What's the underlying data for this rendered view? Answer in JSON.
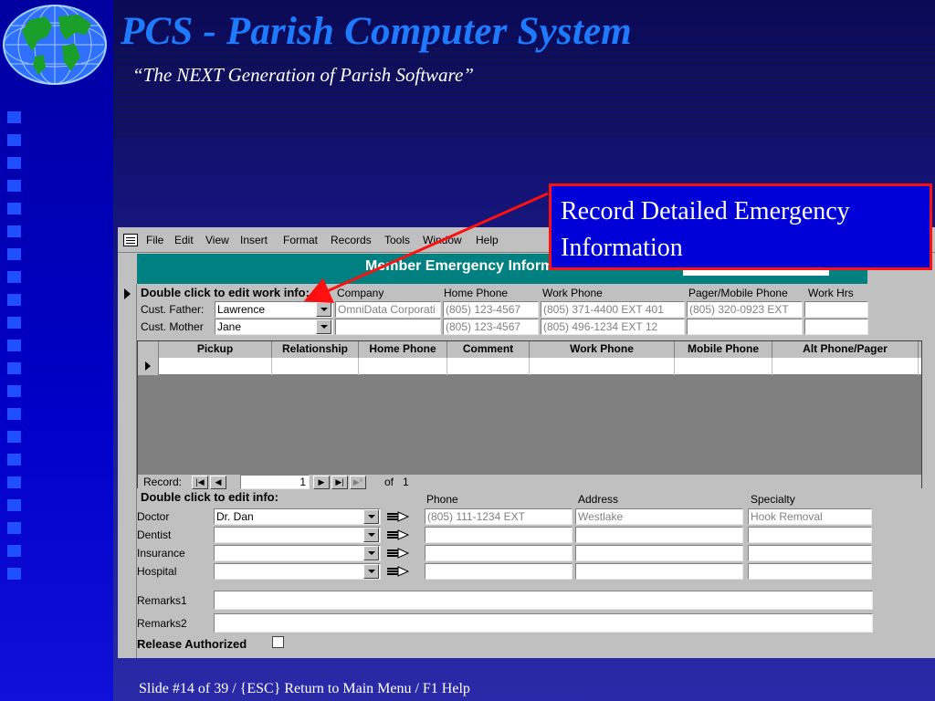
{
  "slide": {
    "title": "PCS - Parish Computer System",
    "subtitle": "“The NEXT Generation of Parish Software”",
    "footer": "Slide #14 of 39 / {ESC} Return to Main Menu / F1 Help"
  },
  "callout": {
    "text": "Record Detailed Emergency Information"
  },
  "menu": [
    "File",
    "Edit",
    "View",
    "Insert",
    "Format",
    "Records",
    "Tools",
    "Window",
    "Help"
  ],
  "form": {
    "title": "Member Emergency Information",
    "work_section": {
      "label": "Double click to edit work info:",
      "columns": [
        "Company",
        "Home Phone",
        "Work Phone",
        "Pager/Mobile Phone",
        "Work Hrs"
      ],
      "father": {
        "label": "Cust. Father:",
        "name": "Lawrence",
        "company": "OmniData Corporati",
        "home_phone": "(805) 123-4567",
        "work_phone": "(805) 371-4400 EXT 401",
        "pager": "(805) 320-0923 EXT",
        "work_hrs": ""
      },
      "mother": {
        "label": "Cust. Mother",
        "name": "Jane",
        "company": "",
        "home_phone": "(805) 123-4567",
        "work_phone": "(805) 496-1234 EXT 12",
        "pager": "",
        "work_hrs": ""
      }
    },
    "pickup_table": {
      "columns": [
        "Pickup",
        "Relationship",
        "Home Phone",
        "Comment",
        "Work Phone",
        "Mobile Phone",
        "Alt Phone/Pager"
      ],
      "record_label": "Record:",
      "record_number": "1",
      "of_label": "of",
      "total": "1"
    },
    "contacts_section": {
      "label": "Double click to edit info:",
      "columns": [
        "Phone",
        "Address",
        "Specialty"
      ],
      "rows": [
        {
          "label": "Doctor",
          "name": "Dr. Dan",
          "phone": "(805) 111-1234 EXT",
          "address": "Westlake",
          "specialty": "Hook Removal"
        },
        {
          "label": "Dentist",
          "name": "",
          "phone": "",
          "address": "",
          "specialty": ""
        },
        {
          "label": "Insurance",
          "name": "",
          "phone": "",
          "address": "",
          "specialty": ""
        },
        {
          "label": "Hospital",
          "name": "",
          "phone": "",
          "address": "",
          "specialty": ""
        }
      ]
    },
    "remarks1_label": "Remarks1",
    "remarks2_label": "Remarks2",
    "release_label": "Release Authorized"
  },
  "colors": {
    "title": "#1e7aff",
    "form_header": "#008080",
    "callout_bg": "#0000d8",
    "callout_border": "#ff1010"
  }
}
